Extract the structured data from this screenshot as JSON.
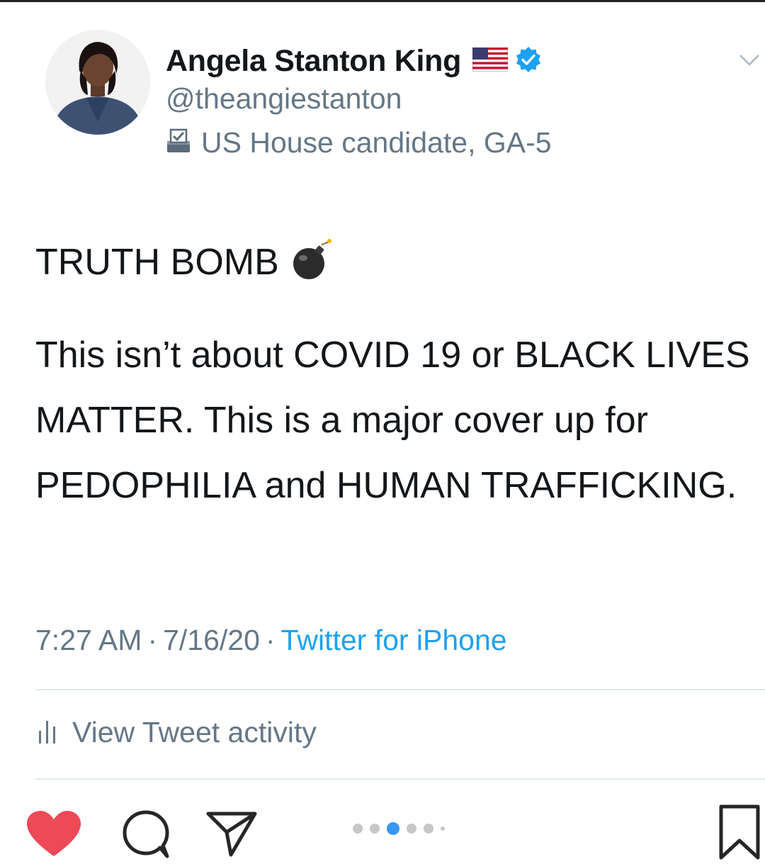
{
  "profile": {
    "display_name": "Angela Stanton King",
    "handle": "@theangiestanton",
    "bio": "US House candidate, GA-5",
    "name_emoji": "us-flag-icon",
    "verified_badge": "verified-icon",
    "bio_icon": "ballot-box-icon"
  },
  "tweet": {
    "title": "TRUTH BOMB",
    "title_emoji": "bomb-icon",
    "body": "This isn’t about COVID 19 or BLACK LIVES MATTER. This is a major cover up for PEDOPHILIA and HUMAN TRAFFICKING.",
    "time": "7:27 AM",
    "separator": "·",
    "date": "7/16/20",
    "source": "Twitter for iPhone"
  },
  "activity": {
    "label": "View Tweet activity",
    "icon": "bar-chart-icon"
  },
  "instagram_bar": {
    "icons": [
      "heart-icon",
      "comment-icon",
      "share-icon",
      "save-icon"
    ],
    "carousel_total": 6,
    "carousel_active": 3
  },
  "colors": {
    "verified_blue": "#1da1f2",
    "link_blue": "#1da1f2",
    "secondary_text": "#657786",
    "heart_red": "#ed4956",
    "carousel_active": "#3897f0"
  }
}
